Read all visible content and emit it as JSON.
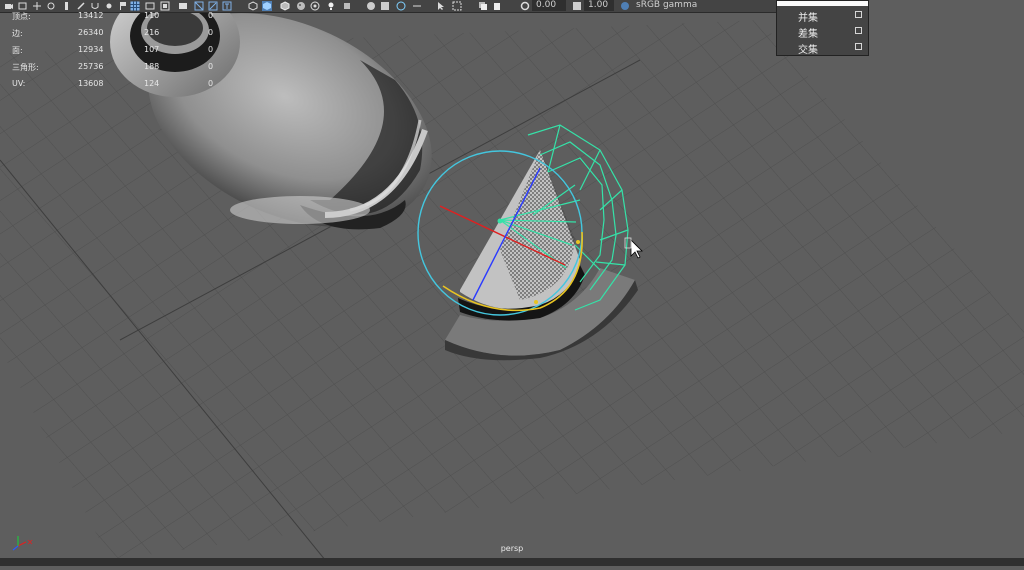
{
  "toolbar": {
    "field1": "0.00",
    "field2": "1.00",
    "colorspace": "sRGB gamma",
    "icons": [
      "camera-icon",
      "select-icon",
      "move-icon",
      "rotate-icon",
      "grid-icon",
      "wireframe-icon",
      "shaded-icon",
      "texture-icon",
      "light-icon",
      "shadow-icon",
      "isolate-icon",
      "xray-icon",
      "gamma-icon"
    ]
  },
  "hud": {
    "rows": [
      {
        "label": "顶点:",
        "c1": "13412",
        "c2": "110",
        "c3": "0"
      },
      {
        "label": "边:",
        "c1": "26340",
        "c2": "216",
        "c3": "0"
      },
      {
        "label": "面:",
        "c1": "12934",
        "c2": "107",
        "c3": "0"
      },
      {
        "label": "三角形:",
        "c1": "25736",
        "c2": "188",
        "c3": "0"
      },
      {
        "label": "UV:",
        "c1": "13608",
        "c2": "124",
        "c3": "0"
      }
    ]
  },
  "menu": {
    "items": [
      {
        "label": "并集"
      },
      {
        "label": "差集"
      },
      {
        "label": "交集"
      }
    ]
  },
  "viewport": {
    "camera": "persp"
  },
  "colors": {
    "background": "#5e5e5e",
    "grid": "#4a4a4a",
    "selection": "#35e2a8",
    "manip_circle": "#44c6de",
    "x_axis": "#e02020",
    "z_axis": "#2a3aff",
    "y_arc": "#e8c422"
  }
}
